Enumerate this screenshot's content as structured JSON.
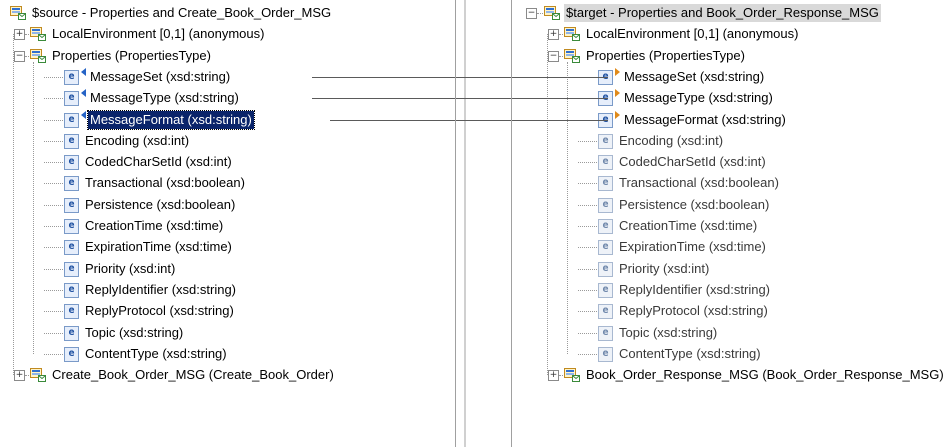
{
  "source": {
    "root_label": "$source - Properties and Create_Book_Order_MSG",
    "local_env_label": "LocalEnvironment [0,1] (anonymous)",
    "properties_label": "Properties (PropertiesType)",
    "items": [
      "MessageSet (xsd:string)",
      "MessageType (xsd:string)",
      "MessageFormat (xsd:string)",
      "Encoding (xsd:int)",
      "CodedCharSetId (xsd:int)",
      "Transactional (xsd:boolean)",
      "Persistence (xsd:boolean)",
      "CreationTime (xsd:time)",
      "ExpirationTime (xsd:time)",
      "Priority (xsd:int)",
      "ReplyIdentifier (xsd:string)",
      "ReplyProtocol (xsd:string)",
      "Topic (xsd:string)",
      "ContentType (xsd:string)"
    ],
    "message_label": "Create_Book_Order_MSG (Create_Book_Order)",
    "selected_item": "MessageFormat (xsd:string)"
  },
  "target": {
    "root_label": "$target - Properties and Book_Order_Response_MSG",
    "local_env_label": "LocalEnvironment [0,1] (anonymous)",
    "properties_label": "Properties (PropertiesType)",
    "items": [
      "MessageSet (xsd:string)",
      "MessageType (xsd:string)",
      "MessageFormat (xsd:string)",
      "Encoding (xsd:int)",
      "CodedCharSetId (xsd:int)",
      "Transactional (xsd:boolean)",
      "Persistence (xsd:boolean)",
      "CreationTime (xsd:time)",
      "ExpirationTime (xsd:time)",
      "Priority (xsd:int)",
      "ReplyIdentifier (xsd:string)",
      "ReplyProtocol (xsd:string)",
      "Topic (xsd:string)",
      "ContentType (xsd:string)"
    ],
    "message_label": "Book_Order_Response_MSG (Book_Order_Response_MSG)"
  },
  "tree_glyphs": {
    "expand": "+",
    "collapse": "−",
    "element": "e"
  },
  "colors": {
    "selection": "#0a246a",
    "map_link": "#2563c6",
    "map_target": "#e08a1a"
  }
}
